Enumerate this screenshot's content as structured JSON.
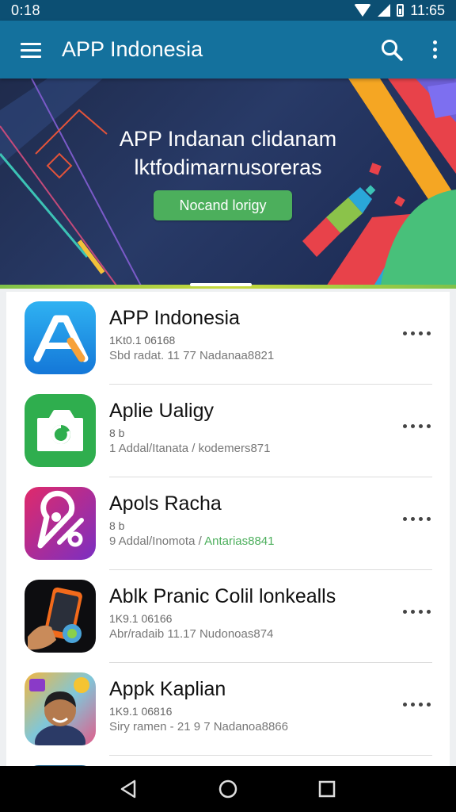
{
  "status_bar": {
    "time": "0:18",
    "right_time": "11:65"
  },
  "app_bar": {
    "title": "APP Indonesia",
    "icons": [
      "menu-icon",
      "search-icon",
      "more-vertical-icon"
    ]
  },
  "banner": {
    "line1": "APP Indanan clidanam",
    "line2": "lktfodimarnusoreras",
    "button_label": "Nocand lorigy"
  },
  "apps": [
    {
      "title": "APP Indonesia",
      "line1": "1Kt0.1 06168",
      "line2": "Sbd radat. 11 77 Nadanaa8821",
      "line2_accent": ""
    },
    {
      "title": "Aplie Ualigy",
      "line1": "8     b",
      "line2": "1 Addal/Itanata / ",
      "line2_accent": "",
      "line2_tail": "kodemers871"
    },
    {
      "title": "Apols Racha",
      "line1": "8     b",
      "line2": "9 Addal/Inomota / ",
      "line2_accent": "Antarias8841"
    },
    {
      "title": "Ablk Pranic Colil lonkealls",
      "line1": "1K9.1 06166",
      "line2": "Abr/radaib 11.17 Nudonoas874",
      "line2_accent": ""
    },
    {
      "title": "Appk Kaplian",
      "line1": "1K9.1 06816",
      "line2": "Siry ramen - 21 9 7 Nadanoa8866",
      "line2_accent": ""
    }
  ],
  "colors": {
    "status_bar": "#0c4f73",
    "app_bar": "#14719d",
    "banner_button": "#4caf5c",
    "nav_bar": "#000000"
  }
}
